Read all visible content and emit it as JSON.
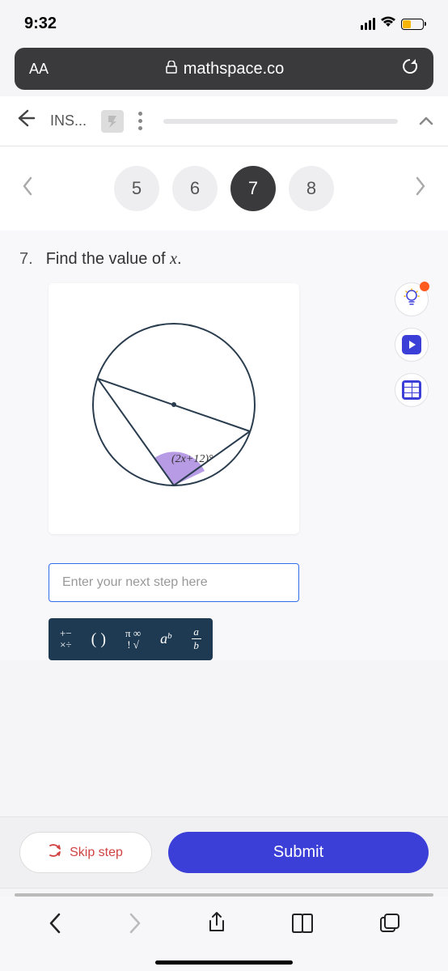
{
  "status": {
    "time": "9:32"
  },
  "browser": {
    "aa": "AA",
    "url": "mathspace.co"
  },
  "nav": {
    "breadcrumb": "INS..."
  },
  "questions": {
    "items": [
      "5",
      "6",
      "7",
      "8"
    ],
    "active_index": 2
  },
  "question": {
    "number": "7.",
    "prompt_pre": "Find the value of ",
    "prompt_var": "x",
    "prompt_post": ".",
    "angle_label": "(2x+12)°"
  },
  "input": {
    "placeholder": "Enter your next step here"
  },
  "toolbar": {
    "ops_r1": "+−",
    "ops_r2": "×÷",
    "paren": "( )",
    "pi_r1": "π ∞",
    "pi_r2": "! √",
    "exp": "a",
    "exp_sup": "b",
    "frac_top": "a",
    "frac_bot": "b"
  },
  "actions": {
    "skip": "Skip step",
    "submit": "Submit"
  }
}
